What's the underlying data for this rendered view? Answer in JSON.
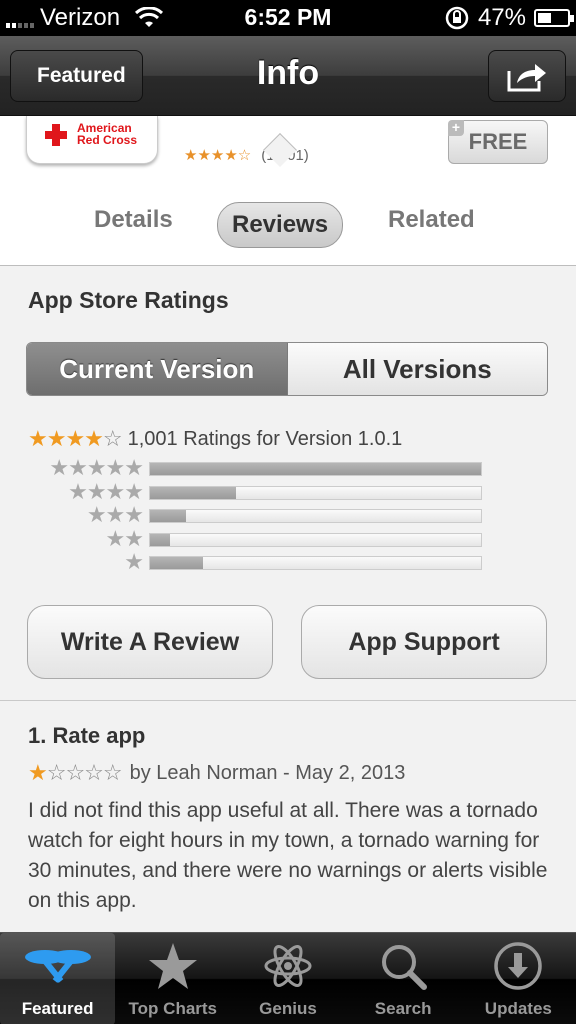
{
  "status_bar": {
    "carrier": "Verizon",
    "time": "6:52 PM",
    "battery": "47%",
    "battery_level": 0.47
  },
  "nav": {
    "back_label": "Featured",
    "title": "Info"
  },
  "app": {
    "icon_text_line1": "American",
    "icon_text_line2": "Red Cross",
    "stars": "★★★★☆",
    "rating_count": "(1,001)",
    "price_label": "FREE"
  },
  "tabs": [
    "Details",
    "Reviews",
    "Related"
  ],
  "ratings": {
    "section_title": "App Store Ratings",
    "segments": [
      "Current Version",
      "All Versions"
    ],
    "summary_stars_filled": "★★★★",
    "summary_stars_empty": "☆",
    "summary_text": "1,001 Ratings for Version 1.0.1",
    "histogram": [
      {
        "stars": "★★★★★",
        "fraction": 1.0
      },
      {
        "stars": "★★★★",
        "fraction": 0.26
      },
      {
        "stars": "★★★",
        "fraction": 0.11
      },
      {
        "stars": "★★",
        "fraction": 0.06
      },
      {
        "stars": "★",
        "fraction": 0.16
      }
    ]
  },
  "actions": {
    "write_review": "Write A Review",
    "app_support": "App Support"
  },
  "review": {
    "title": "1. Rate app",
    "stars_filled": "★",
    "stars_empty": "☆☆☆☆",
    "byline": "by Leah Norman - May 2, 2013",
    "body": "I did not find this app useful at all. There was a tornado watch for eight hours in my town, a tornado warning for 30 minutes, and there were no warnings or alerts visible on this app."
  },
  "tab_bar": {
    "items": [
      "Featured",
      "Top Charts",
      "Genius",
      "Search",
      "Updates"
    ],
    "icons": [
      "featured-icon",
      "star-icon",
      "atom-icon",
      "search-icon",
      "download-icon"
    ]
  }
}
